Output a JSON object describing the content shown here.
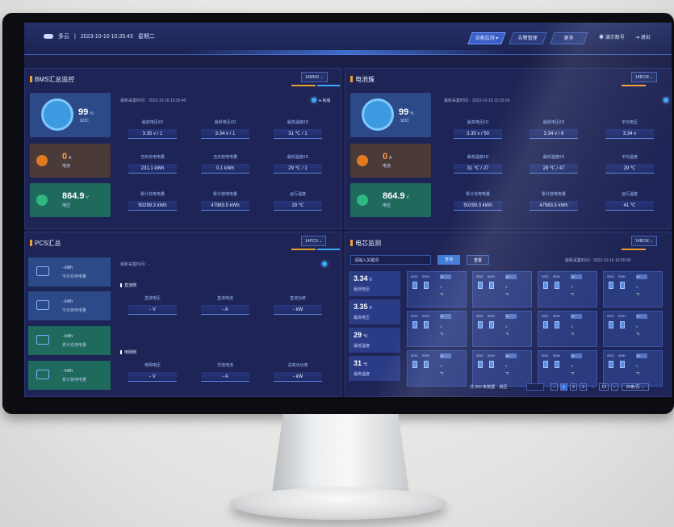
{
  "header": {
    "weather": "多云",
    "separator": "|",
    "datetime": "2023-10-10 10:35:43",
    "weekday": "星期二",
    "nav": [
      "设备监测 ▾",
      "告警管理",
      "更多"
    ],
    "user": "演示账号",
    "logout": "退出"
  },
  "bms": {
    "title": "BMS汇总监控",
    "select": "14MMS ⌄",
    "stamp": "最新采集时间：2023-10-10 10:35:40",
    "status": "● 就绪",
    "soc": {
      "value": "99",
      "unit": "%",
      "label": "SOC"
    },
    "current": {
      "value": "0",
      "unit": "A",
      "label": "电流"
    },
    "voltage": {
      "value": "864.9",
      "unit": "V",
      "label": "电压"
    },
    "metrics": [
      {
        "label": "最高电压/ID",
        "value": "3.35 v / 1"
      },
      {
        "label": "最低电压/ID",
        "value": "3.34 v / 1"
      },
      {
        "label": "最高温度/ID",
        "value": "31 ℃ / 1"
      },
      {
        "label": "当天充电电量",
        "value": "231.1 kWh"
      },
      {
        "label": "当天放电电量",
        "value": "0.1 kWh"
      },
      {
        "label": "最低温度/ID",
        "value": "29 ℃ / 1"
      },
      {
        "label": "累计充电电量",
        "value": "50299.3 kWh"
      },
      {
        "label": "累计放电电量",
        "value": "47983.5 kWh"
      },
      {
        "label": "运行温度",
        "value": "29 ℃"
      }
    ]
  },
  "cluster": {
    "title": "电池簇",
    "select": "14BCM ⌄",
    "stamp": "最新采集时间：2023-10-10 10:35:00",
    "soc": {
      "value": "99",
      "unit": "%",
      "label": "SOC"
    },
    "current": {
      "value": "0",
      "unit": "A",
      "label": "电流"
    },
    "voltage": {
      "value": "864.9",
      "unit": "V",
      "label": "电压"
    },
    "metrics": [
      {
        "label": "最高电压/ID",
        "value": "3.35 v / 50"
      },
      {
        "label": "最低电压/ID",
        "value": "3.34 v / 6"
      },
      {
        "label": "平均电压",
        "value": "3.34 v"
      },
      {
        "label": "最高温度/ID",
        "value": "31 ℃ / 27"
      },
      {
        "label": "最低温度/ID",
        "value": "29 ℃ / 47"
      },
      {
        "label": "平均温度",
        "value": "29 ℃"
      },
      {
        "label": "累计充电电量",
        "value": "50299.3 kWh"
      },
      {
        "label": "累计放电电量",
        "value": "47983.5 kWh"
      },
      {
        "label": "运行温度",
        "value": "41 ℃"
      }
    ]
  },
  "pcs": {
    "title": "PCS汇总",
    "select": "14PCS ⌄",
    "stamp": "最新采集时间：-",
    "items": [
      {
        "value": "- kWh",
        "label": "今日充电电量"
      },
      {
        "value": "- kWh",
        "label": "今日放电电量"
      },
      {
        "value": "- kWh",
        "label": "累计充电电量"
      },
      {
        "value": "- kWh",
        "label": "累计放电电量"
      }
    ],
    "dc_title": "直流侧",
    "dc": [
      {
        "label": "直流电压",
        "value": "- V"
      },
      {
        "label": "直流电流",
        "value": "- A"
      },
      {
        "label": "直流功率",
        "value": "- kW"
      }
    ],
    "ac_title": "电网侧",
    "ac": [
      {
        "label": "电网电压",
        "value": "- V"
      },
      {
        "label": "交流电流",
        "value": "- A"
      },
      {
        "label": "总有功功率",
        "value": "- kW"
      }
    ]
  },
  "cells": {
    "title": "电芯监测",
    "select": "14BCM ⌄",
    "search_placeholder": "请输入关键词",
    "search_btn": "查询",
    "reset_btn": "重置",
    "stamp": "最新采集时间：2023-10-10 10:35:00",
    "stats": [
      {
        "value": "3.34",
        "unit": "V",
        "label": "最低电压"
      },
      {
        "value": "3.35",
        "unit": "V",
        "label": "最高电压"
      },
      {
        "value": "29",
        "unit": "℃",
        "label": "最低温度"
      },
      {
        "value": "31",
        "unit": "℃",
        "label": "最高温度"
      }
    ],
    "card_soc": "SOC",
    "card_soh": "SOH",
    "card_box": "1#",
    "card_v": "V",
    "card_t": "℃",
    "pager": {
      "total": "共 260 条数据",
      "jump": "跳至",
      "pages": [
        "1",
        "2",
        "3",
        "...",
        "13"
      ],
      "per_page": "20条/页 ⌄"
    }
  },
  "colors": {
    "accent": "#f0a030",
    "blue": "#3fa8ff",
    "green": "#1e6a5c"
  }
}
